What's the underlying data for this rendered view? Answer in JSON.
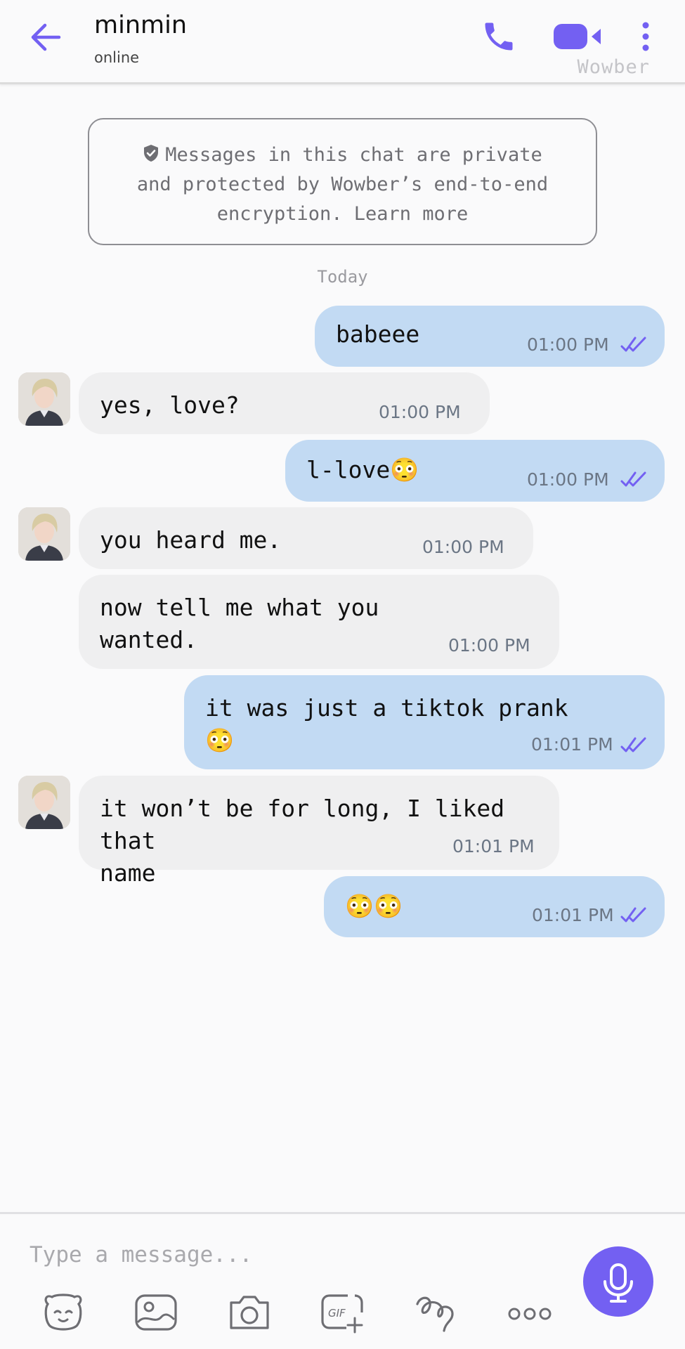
{
  "header": {
    "contact_name": "minmin",
    "status": "online",
    "brand": "Wowber",
    "accent_color": "#7360f2"
  },
  "notice": {
    "line1": "Messages in this chat are private",
    "line2": "and protected by Wowber’s end-to-end",
    "line3": "encryption. Learn more"
  },
  "day_separator": "Today",
  "messages": [
    {
      "direction": "out",
      "text": "babeee",
      "time": "01:00 PM",
      "read": true
    },
    {
      "direction": "in",
      "text": "yes, love?",
      "time": "01:00 PM"
    },
    {
      "direction": "out",
      "text": "l-love😳",
      "time": "01:00 PM",
      "read": true
    },
    {
      "direction": "in",
      "text": "you heard me.",
      "time": "01:00 PM"
    },
    {
      "direction": "in",
      "text": "now tell me what you\nwanted.",
      "time": "01:00 PM"
    },
    {
      "direction": "out",
      "text": "it was just a tiktok prank\n😳",
      "time": "01:01 PM",
      "read": true
    },
    {
      "direction": "in",
      "text": "it won’t be for long, I liked that\nname",
      "time": "01:01 PM"
    },
    {
      "direction": "out",
      "text": "😳😳",
      "time": "01:01 PM",
      "read": true
    }
  ],
  "composer": {
    "placeholder": "Type a message...",
    "tools": [
      "sticker-icon",
      "gallery-icon",
      "camera-icon",
      "gif-icon",
      "doodle-icon",
      "more-options-icon"
    ],
    "mic_icon": "microphone-icon"
  },
  "colors": {
    "outgoing_bubble": "#c2daf3",
    "incoming_bubble": "#efeff0",
    "accent": "#7360f2"
  }
}
